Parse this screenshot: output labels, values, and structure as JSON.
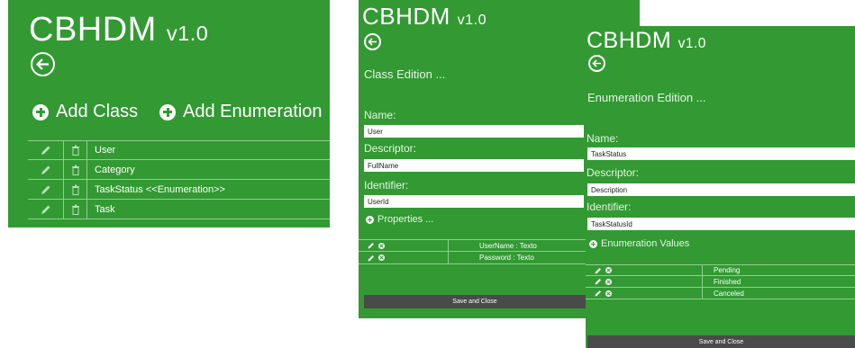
{
  "app": {
    "title": "CBHDM",
    "version": "v1.0"
  },
  "class_list_view": {
    "add_class_label": "Add Class",
    "add_enumeration_label": "Add Enumeration",
    "items": [
      {
        "label": "User"
      },
      {
        "label": "Category"
      },
      {
        "label": "TaskStatus <<Enumeration>>"
      },
      {
        "label": "Task"
      }
    ]
  },
  "class_edition": {
    "heading": "Class Edition ...",
    "name_label": "Name:",
    "name_value": "User",
    "descriptor_label": "Descriptor:",
    "descriptor_value": "FullName",
    "identifier_label": "Identifier:",
    "identifier_value": "UserId",
    "properties_label": "Properties ...",
    "properties": [
      {
        "label": "UserName : Texto"
      },
      {
        "label": "Password : Texto"
      }
    ],
    "save_label": "Save and Close"
  },
  "enumeration_edition": {
    "heading": "Enumeration Edition ...",
    "name_label": "Name:",
    "name_value": "TaskStatus",
    "descriptor_label": "Descriptor:",
    "descriptor_value": "Description",
    "identifier_label": "Identifier:",
    "identifier_value": "TaskStatusId",
    "values_label": "Enumeration Values",
    "values": [
      {
        "label": "Pending"
      },
      {
        "label": "Finished"
      },
      {
        "label": "Canceled"
      }
    ],
    "save_label": "Save and Close"
  },
  "colors": {
    "panel_green": "#339933",
    "row_border": "#8fcf8f",
    "save_bar": "#4a4a4a"
  },
  "icons": [
    "back-arrow-icon",
    "plus-circle-icon",
    "pencil-icon",
    "trash-icon",
    "close-circle-icon"
  ]
}
